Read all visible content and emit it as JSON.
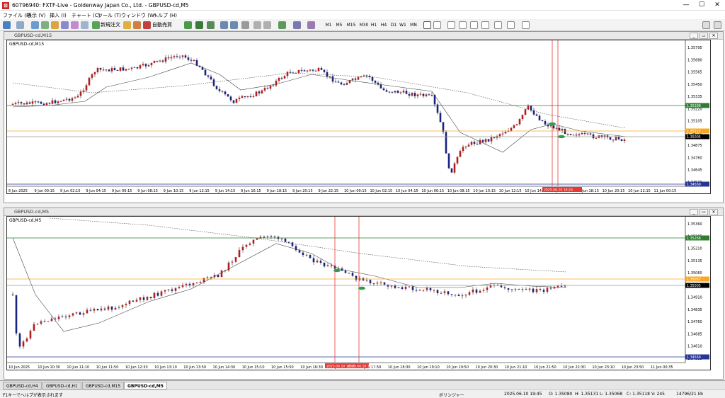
{
  "window": {
    "title": "60796940: FXTF-Live - Goldenway Japan Co., Ltd. - GBPUSD-cd,M5"
  },
  "menu": [
    "ファイル (F)",
    "表示 (V)",
    "挿入 (I)",
    "チャート (C)",
    "ツール (T)",
    "ウィンドウ (W)",
    "ヘルプ (H)"
  ],
  "toolbar": {
    "new_order": "新規注文",
    "auto_trade": "自動売買",
    "timeframes": [
      "M1",
      "M5",
      "M15",
      "M30",
      "H1",
      "H4",
      "D1",
      "W1",
      "MN"
    ]
  },
  "colors": {
    "bull": "#b71c1c",
    "bear": "#1a237e",
    "green": "#2e7d32",
    "orange": "#f9a825",
    "blue": "#283593",
    "red": "#e53935"
  },
  "pane1": {
    "title": "GBPUSD-cd,M15",
    "symbol": "GBPUSD-cd,M15",
    "yaxis": [
      "1.35795",
      "1.35680",
      "1.35565",
      "1.35450",
      "1.35335",
      "1.35220",
      "1.35105",
      "1.34990",
      "1.34875",
      "1.34760",
      "1.34645",
      "1.34530"
    ],
    "xaxis": [
      "6 Jun 2025",
      "9 Jun 00:15",
      "9 Jun 02:15",
      "9 Jun 04:15",
      "9 Jun 06:15",
      "9 Jun 08:15",
      "9 Jun 10:15",
      "9 Jun 12:15",
      "9 Jun 14:15",
      "9 Jun 16:15",
      "9 Jun 18:15",
      "9 Jun 20:15",
      "9 Jun 22:15",
      "10 Jun 00:15",
      "10 Jun 02:15",
      "10 Jun 04:15",
      "10 Jun 06:15",
      "10 Jun 08:15",
      "10 Jun 10:15",
      "10 Jun 12:15",
      "10 Jun 14:15",
      "10 Jun 16:15",
      "10 Jun 18:15",
      "10 Jun 20:15",
      "10 Jun 22:15",
      "11 Jun 00:15"
    ],
    "levels": {
      "green": "1.35288",
      "orange": "1.35117",
      "current": "1.35005",
      "blue": "1.34569"
    },
    "time_marker": "2025.06.10 19:25"
  },
  "pane2": {
    "title": "GBPUSD-cd,M5",
    "symbol": "GBPUSD-cd,M5",
    "yaxis": [
      "1.35360",
      "1.35285",
      "1.35210",
      "1.35135",
      "1.35060",
      "1.34985",
      "1.34910",
      "1.34835",
      "1.34760",
      "1.34685",
      "1.34610",
      "1.34535"
    ],
    "xaxis": [
      "10 Jun 2025",
      "10 Jun 10:30",
      "10 Jun 11:10",
      "10 Jun 11:50",
      "10 Jun 12:30",
      "10 Jun 13:10",
      "10 Jun 13:50",
      "10 Jun 14:30",
      "10 Jun 15:10",
      "10 Jun 15:50",
      "10 Jun 16:30",
      "10 Jun 17:10",
      "10 Jun 17:50",
      "10 Jun 18:30",
      "10 Jun 19:10",
      "10 Jun 19:50",
      "10 Jun 20:30",
      "10 Jun 21:10",
      "10 Jun 21:50",
      "10 Jun 22:30",
      "10 Jun 23:10",
      "10 Jun 23:50",
      "11 Jun 00:35"
    ],
    "levels": {
      "green": "1.35268",
      "orange": "1.35057",
      "current": "1.35005",
      "blue": "1.34569"
    },
    "time_marker1": "2025.06.10 18:30",
    "time_marker2": "2025.06.10 19:25"
  },
  "tabs": [
    "GBPUSD-cd,H4",
    "GBPUSD-cd,H1",
    "GBPUSD-cd,M15",
    "GBPUSD-cd,M5"
  ],
  "status": {
    "help": "F1キーでヘルプが表示されます",
    "profile": "ボリンジャー",
    "time": "2025.06.10 19:45",
    "open": "O: 1.35080",
    "high": "H: 1.35131",
    "low": "L: 1.35068",
    "close": "C: 1.35118",
    "volume": "V: 245",
    "traffic": "14796/21 kb"
  }
}
